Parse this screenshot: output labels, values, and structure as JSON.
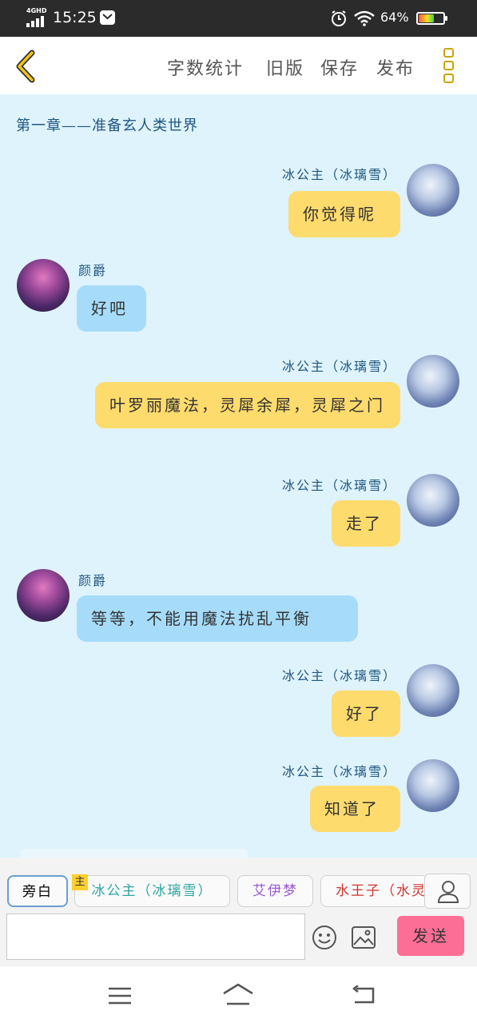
{
  "status_bar": {
    "network": "4GHD",
    "time": "15:25",
    "battery_percent_text": "64%",
    "battery_level": 0.64
  },
  "header": {
    "buttons": [
      "字数统计",
      "旧版",
      "保存",
      "发布"
    ]
  },
  "chapter_title": "第一章——准备玄人类世界",
  "messages": [
    {
      "side": "right",
      "name": "冰公主（冰璃雪）",
      "text": "你觉得呢"
    },
    {
      "side": "left",
      "name": "颜爵",
      "text": "好吧"
    },
    {
      "side": "right",
      "name": "冰公主（冰璃雪）",
      "text": "叶罗丽魔法，灵犀余犀，灵犀之门"
    },
    {
      "side": "right",
      "name": "冰公主（冰璃雪）",
      "text": "走了"
    },
    {
      "side": "left",
      "name": "颜爵",
      "text": "等等，不能用魔法扰乱平衡"
    },
    {
      "side": "right",
      "name": "冰公主（冰璃雪）",
      "text": "好了"
    },
    {
      "side": "right",
      "name": "冰公主（冰璃雪）",
      "text": "知道了"
    }
  ],
  "composer": {
    "roles": [
      {
        "label": "旁白",
        "color": "#555555"
      },
      {
        "label": "冰公主（冰璃雪）",
        "color": "#2aa6a0"
      },
      {
        "label": "艾伊梦",
        "color": "#9b59d0"
      },
      {
        "label": "水王子（水灵",
        "color": "#d0342c"
      }
    ],
    "main_badge": "主",
    "input_value": "",
    "send_label": "发送"
  },
  "colors": {
    "chat_bg": "#dff3fc",
    "bubble_self": "#fedb6d",
    "bubble_other": "#a6dcf9",
    "send_button": "#fd6e97",
    "accent": "#caa512"
  }
}
